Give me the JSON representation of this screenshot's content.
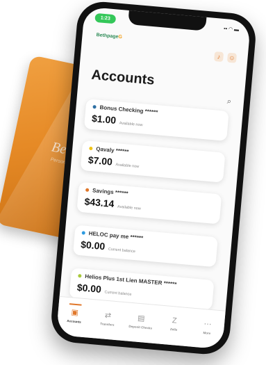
{
  "card": {
    "name": "Beth",
    "subtitle": "Personal Che"
  },
  "status": {
    "time": "1:23",
    "right": "▪▪ ◠ ▬"
  },
  "header": {
    "logo_text": "Bethpage",
    "logo_mark": "G"
  },
  "page": {
    "title": "Accounts"
  },
  "accounts": [
    {
      "name": "Bonus Checking ******",
      "amount": "$1.00",
      "label": "Available now",
      "dot_color": "#2e6fa3"
    },
    {
      "name": "Qavaly ******",
      "amount": "$7.00",
      "label": "Available now",
      "dot_color": "#f0c419"
    },
    {
      "name": "Savings ******",
      "amount": "$43.14",
      "label": "Available now",
      "dot_color": "#e0772a"
    },
    {
      "name": "HELOC pay me ******",
      "amount": "$0.00",
      "label": "Current balance",
      "dot_color": "#2e9be0"
    },
    {
      "name": "Helios Plus 1st Lien MASTER ******",
      "amount": "$0.00",
      "label": "Current balance",
      "dot_color": "#a8c83a"
    }
  ],
  "tabs": [
    {
      "label": "Accounts",
      "icon": "accounts-icon",
      "glyph": "▣",
      "active": true
    },
    {
      "label": "Transfers",
      "icon": "transfers-icon",
      "glyph": "⇄",
      "active": false
    },
    {
      "label": "Deposit Checks",
      "icon": "deposit-icon",
      "glyph": "▤",
      "active": false
    },
    {
      "label": "Zelle",
      "icon": "zelle-icon",
      "glyph": "Z",
      "active": false
    },
    {
      "label": "More",
      "icon": "more-icon",
      "glyph": "⋯",
      "active": false
    }
  ],
  "colors": {
    "accent": "#e0772a",
    "card": "#e68a26"
  }
}
